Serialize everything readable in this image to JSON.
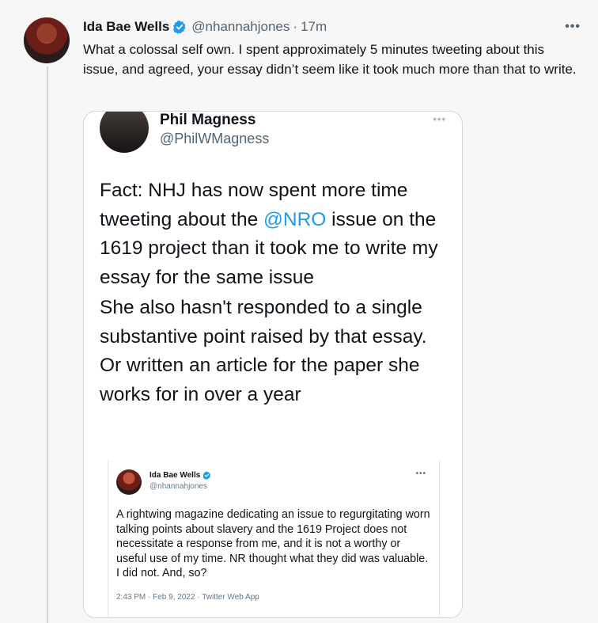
{
  "tweet": {
    "author_name": "Ida Bae Wells",
    "handle": "@nhannahjones",
    "separator": "·",
    "time": "17m",
    "more": "•••",
    "text": "What a colossal self own. I spent approximately 5 minutes tweeting about this issue, and agreed, your essay didn’t seem like it took much more than that to write."
  },
  "quoted": {
    "author_name": "Phil Magness",
    "handle": "@PhilWMagness",
    "more": "•••",
    "p1_before": "Fact: NHJ has now spent more time tweeting about the ",
    "p1_mention": "@NRO",
    "p1_after": " issue on the 1619 project than it took me to write my essay for the same issue",
    "p2": "She also hasn't responded to a single substantive point raised by that essay. Or written an article for the paper she works for in over a year"
  },
  "inner_tweet": {
    "author_name": "Ida Bae Wells",
    "handle": "@nhannahjones",
    "more": "•••",
    "text": "A rightwing magazine dedicating an issue to regurgitating worn talking points about slavery and the 1619 Project does not necessitate a response from me, and it is not a worthy or useful use of my time. NR thought what they did was valuable. I did not. And, so?",
    "meta": "2:43 PM · Feb 9, 2022 · Twitter Web App"
  },
  "icons": {
    "verified": "verified-badge-icon",
    "more": "more-options-icon"
  },
  "colors": {
    "accent": "#1d9bf0",
    "text": "#0f1419",
    "secondary": "#536471",
    "background": "#f7f7f7"
  }
}
